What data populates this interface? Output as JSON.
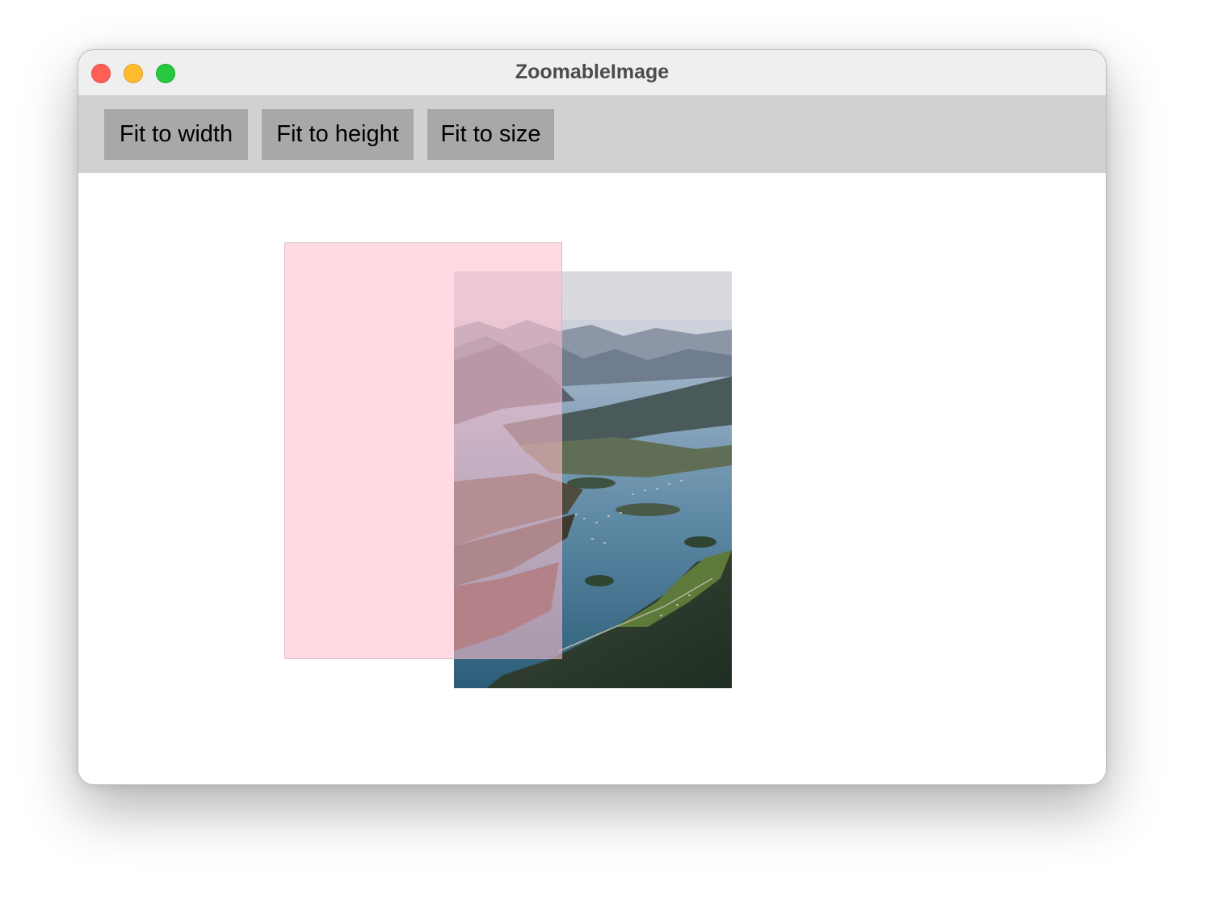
{
  "window": {
    "title": "ZoomableImage"
  },
  "toolbar": {
    "fit_width_label": "Fit to width",
    "fit_height_label": "Fit to height",
    "fit_size_label": "Fit to size"
  },
  "image": {
    "subject": "aerial fjord landscape"
  },
  "colors": {
    "toolbar_bg": "#d1d1d1",
    "button_bg": "#a8a8a8",
    "overlay": "#ffc0ce"
  }
}
